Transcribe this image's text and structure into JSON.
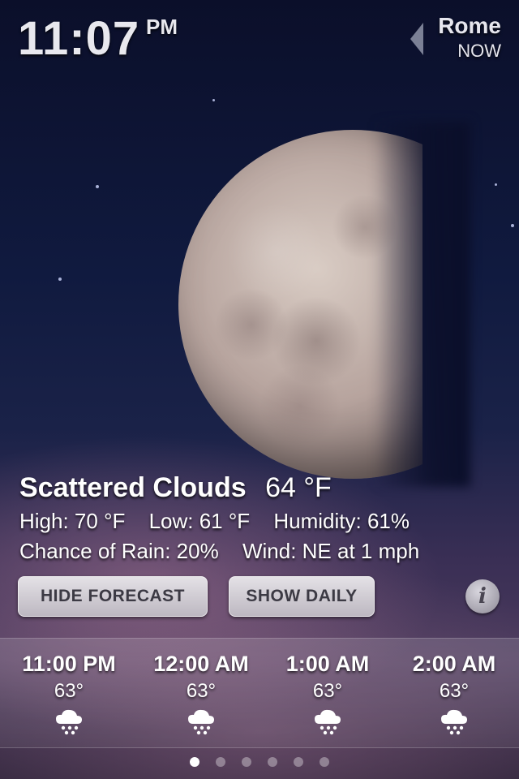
{
  "clock": {
    "time": "11:07",
    "ampm": "PM"
  },
  "location": {
    "city": "Rome",
    "period": "NOW"
  },
  "current": {
    "condition": "Scattered Clouds",
    "temperature": "64 °F",
    "high": "High: 70 °F",
    "low": "Low: 61 °F",
    "humidity": "Humidity: 61%",
    "rain_chance": "Chance of Rain: 20%",
    "wind": "Wind: NE at 1 mph"
  },
  "buttons": {
    "hide_forecast": "HIDE FORECAST",
    "show_daily": "SHOW DAILY",
    "info": "i"
  },
  "forecast": [
    {
      "time": "11:00 PM",
      "temp": "63°",
      "icon": "snow-cloud-icon"
    },
    {
      "time": "12:00 AM",
      "temp": "63°",
      "icon": "snow-cloud-icon"
    },
    {
      "time": "1:00 AM",
      "temp": "63°",
      "icon": "snow-cloud-icon"
    },
    {
      "time": "2:00 AM",
      "temp": "63°",
      "icon": "snow-cloud-icon"
    }
  ],
  "pager": {
    "pages": 6,
    "active": 0
  },
  "colors": {
    "button_text": "#3c3a44",
    "sky_top": "#0b0f2a",
    "text": "#ffffff"
  }
}
